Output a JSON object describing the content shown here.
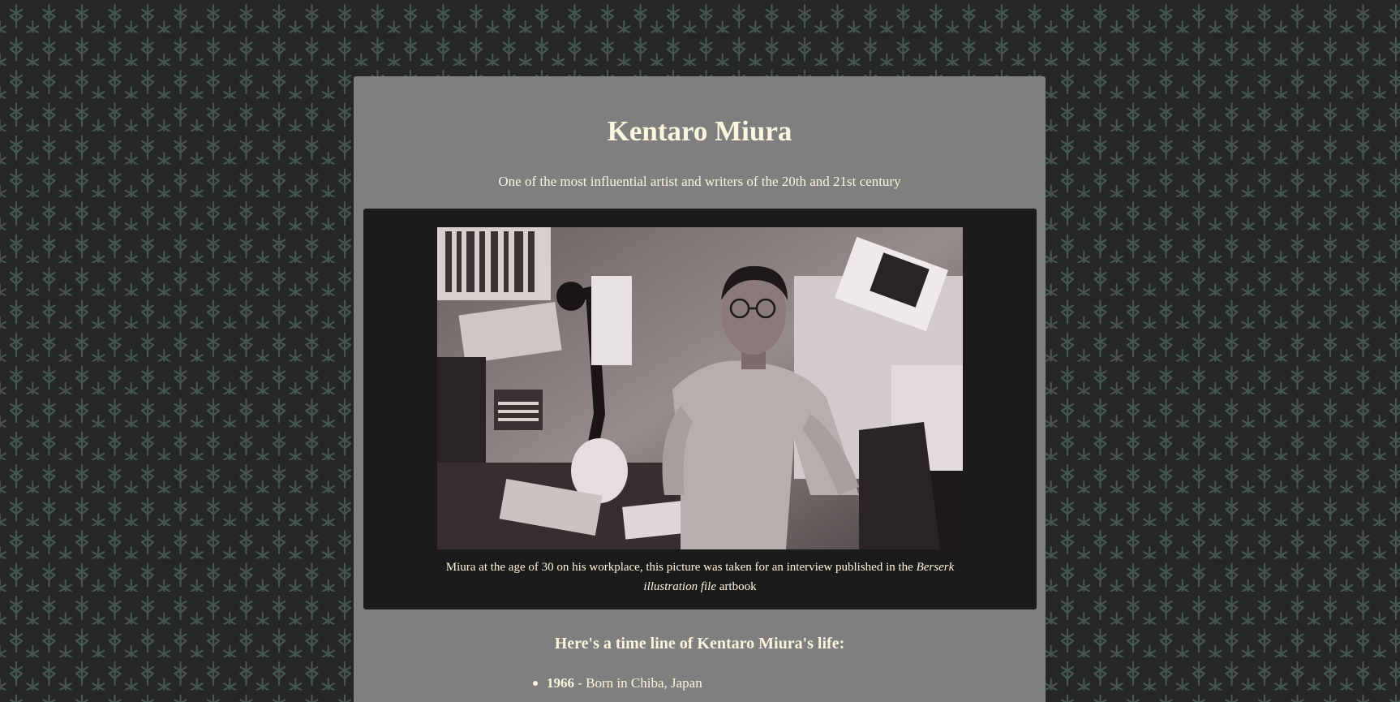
{
  "page": {
    "title": "Kentaro Miura",
    "subtitle": "One of the most influential artist and writers of the 20th and 21st century"
  },
  "image": {
    "caption_before": "Miura at the age of 30 on his workplace, this picture was taken for an interview published in the ",
    "caption_italic": "Berserk illustration file",
    "caption_after": " artbook"
  },
  "tribute": {
    "heading": "Here's a time line of Kentaro Miura's life:",
    "timeline": [
      {
        "year": "1966",
        "text": " - Born in Chiba, Japan"
      }
    ]
  },
  "colors": {
    "page_background": "#252727",
    "pattern": "#465552",
    "panel": "#7f7f7f",
    "image_panel": "#1b1b1b",
    "text": "#fbf6de"
  }
}
